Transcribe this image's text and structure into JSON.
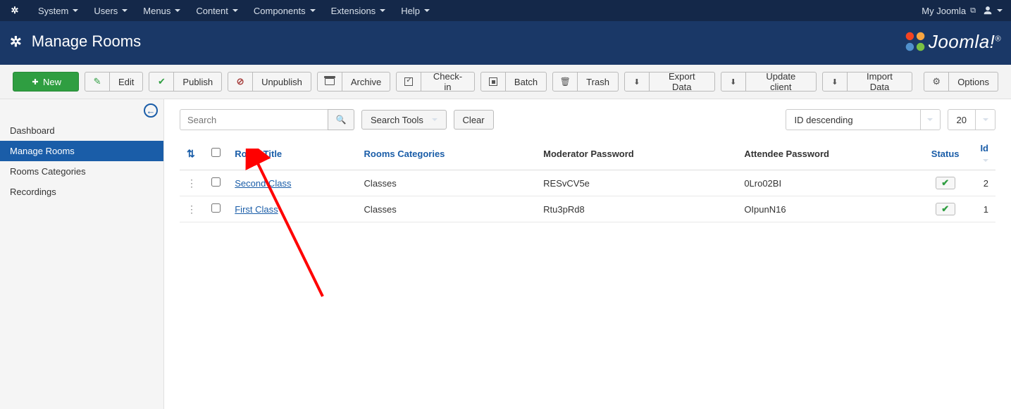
{
  "topmenu": {
    "items": [
      "System",
      "Users",
      "Menus",
      "Content",
      "Components",
      "Extensions",
      "Help"
    ],
    "site_name": "My Joomla"
  },
  "header": {
    "title": "Manage Rooms"
  },
  "toolbar": {
    "new_": "New",
    "edit": "Edit",
    "publish": "Publish",
    "unpublish": "Unpublish",
    "archive": "Archive",
    "checkin": "Check-in",
    "batch": "Batch",
    "trash": "Trash",
    "export_data": "Export Data",
    "update_client": "Update client",
    "import_data": "Import Data",
    "options": "Options"
  },
  "sidebar": {
    "items": [
      {
        "label": "Dashboard",
        "active": false
      },
      {
        "label": "Manage Rooms",
        "active": true
      },
      {
        "label": "Rooms Categories",
        "active": false
      },
      {
        "label": "Recordings",
        "active": false
      }
    ]
  },
  "filters": {
    "search_placeholder": "Search",
    "search_tools": "Search Tools",
    "clear": "Clear",
    "order_by": "ID descending",
    "limit": "20"
  },
  "table": {
    "headers": {
      "room_title": "Room Title",
      "rooms_categories": "Rooms Categories",
      "moderator_password": "Moderator Password",
      "attendee_password": "Attendee Password",
      "status": "Status",
      "id": "Id"
    },
    "rows": [
      {
        "title": "Second Class",
        "category": "Classes",
        "mod_pass": "RESvCV5e",
        "att_pass": "0Lro02BI",
        "published": true,
        "id": "2"
      },
      {
        "title": "First Class",
        "category": "Classes",
        "mod_pass": "Rtu3pRd8",
        "att_pass": "OIpunN16",
        "published": true,
        "id": "1"
      }
    ]
  }
}
